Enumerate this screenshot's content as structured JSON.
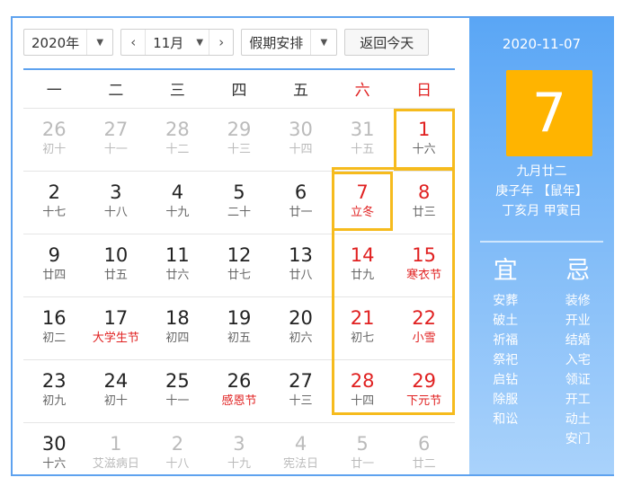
{
  "toolbar": {
    "year": "2020年",
    "month": "11月",
    "holiday": "假期安排",
    "today_button": "返回今天",
    "prev": "‹",
    "next": "›",
    "caret": "▼"
  },
  "weekdays": [
    "一",
    "二",
    "三",
    "四",
    "五",
    "六",
    "日"
  ],
  "rows": [
    [
      {
        "d": "26",
        "l": "初十",
        "o": true
      },
      {
        "d": "27",
        "l": "十一",
        "o": true
      },
      {
        "d": "28",
        "l": "十二",
        "o": true
      },
      {
        "d": "29",
        "l": "十三",
        "o": true
      },
      {
        "d": "30",
        "l": "十四",
        "o": true
      },
      {
        "d": "31",
        "l": "十五",
        "o": true
      },
      {
        "d": "1",
        "l": "十六"
      }
    ],
    [
      {
        "d": "2",
        "l": "十七"
      },
      {
        "d": "3",
        "l": "十八"
      },
      {
        "d": "4",
        "l": "十九"
      },
      {
        "d": "5",
        "l": "二十"
      },
      {
        "d": "6",
        "l": "廿一"
      },
      {
        "d": "7",
        "l": "立冬",
        "f": true
      },
      {
        "d": "8",
        "l": "廿三"
      }
    ],
    [
      {
        "d": "9",
        "l": "廿四"
      },
      {
        "d": "10",
        "l": "廿五"
      },
      {
        "d": "11",
        "l": "廿六"
      },
      {
        "d": "12",
        "l": "廿七"
      },
      {
        "d": "13",
        "l": "廿八"
      },
      {
        "d": "14",
        "l": "廿九"
      },
      {
        "d": "15",
        "l": "寒衣节",
        "f": true
      }
    ],
    [
      {
        "d": "16",
        "l": "初二"
      },
      {
        "d": "17",
        "l": "大学生节",
        "f": true
      },
      {
        "d": "18",
        "l": "初四"
      },
      {
        "d": "19",
        "l": "初五"
      },
      {
        "d": "20",
        "l": "初六"
      },
      {
        "d": "21",
        "l": "初七"
      },
      {
        "d": "22",
        "l": "小雪",
        "f": true
      }
    ],
    [
      {
        "d": "23",
        "l": "初九"
      },
      {
        "d": "24",
        "l": "初十"
      },
      {
        "d": "25",
        "l": "十一"
      },
      {
        "d": "26",
        "l": "感恩节",
        "f": true
      },
      {
        "d": "27",
        "l": "十三"
      },
      {
        "d": "28",
        "l": "十四"
      },
      {
        "d": "29",
        "l": "下元节",
        "f": true
      }
    ],
    [
      {
        "d": "30",
        "l": "十六"
      },
      {
        "d": "1",
        "l": "艾滋病日",
        "o": true
      },
      {
        "d": "2",
        "l": "十八",
        "o": true
      },
      {
        "d": "3",
        "l": "十九",
        "o": true
      },
      {
        "d": "4",
        "l": "宪法日",
        "o": true
      },
      {
        "d": "5",
        "l": "廿一",
        "o": true
      },
      {
        "d": "6",
        "l": "廿二",
        "o": true
      }
    ]
  ],
  "panel": {
    "date": "2020-11-07",
    "day": "7",
    "lunar": "九月廿二",
    "year_gz": "庚子年 【鼠年】",
    "month_day_gz": "丁亥月 甲寅日",
    "yi_label": "宜",
    "ji_label": "忌",
    "yi": [
      "安葬",
      "破土",
      "祈福",
      "祭祀",
      "启钻",
      "除服",
      "和讼"
    ],
    "ji": [
      "装修",
      "开业",
      "结婚",
      "入宅",
      "领证",
      "开工",
      "动土",
      "安门"
    ]
  }
}
